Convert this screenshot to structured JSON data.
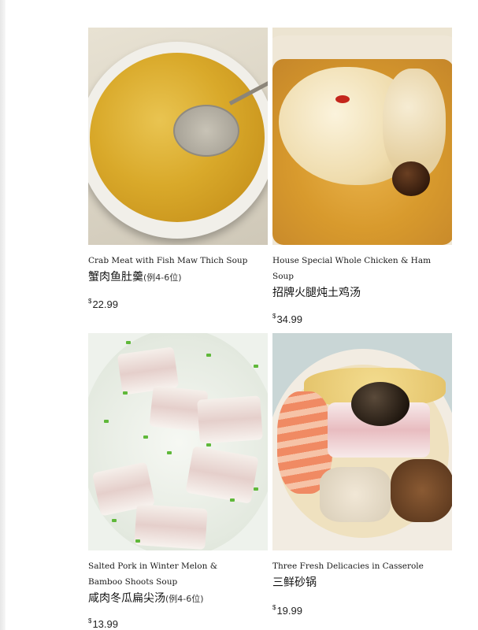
{
  "items": [
    {
      "name_en": "Crab Meat with Fish Maw Thich Soup",
      "name_cn": "蟹肉鱼肚羹",
      "note_cn": "(例4-6位)",
      "currency": "$",
      "price": "22.99"
    },
    {
      "name_en": "House Special Whole Chicken & Ham Soup",
      "name_cn": "招牌火腿炖土鸡汤",
      "note_cn": "",
      "currency": "$",
      "price": "34.99"
    },
    {
      "name_en_line1": "Salted Pork in Winter Melon &",
      "name_en_line2": "Bamboo Shoots Soup",
      "name_cn": "咸肉冬瓜扁尖汤",
      "note_cn": "(例4-6位)",
      "currency": "$",
      "price": "13.99"
    },
    {
      "name_en": "Three Fresh Delicacies in Casserole",
      "name_cn": "三鲜砂锅",
      "note_cn": "",
      "currency": "$",
      "price": "19.99"
    }
  ]
}
